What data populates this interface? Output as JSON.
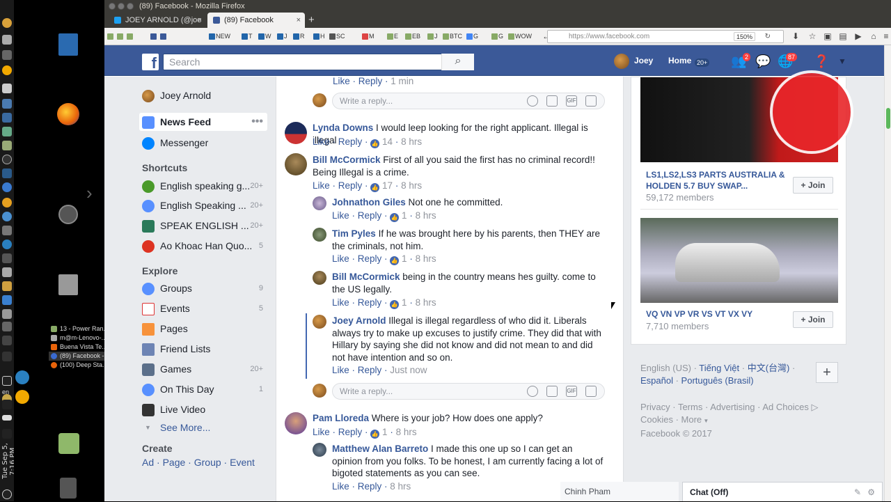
{
  "window": {
    "title": "(89) Facebook - Mozilla Firefox"
  },
  "os": {
    "lang": "en",
    "clock": "Tue Sep 5, 7:16 PM"
  },
  "tasks": [
    {
      "label": "13 - Power Ran..."
    },
    {
      "label": "m@m-Lenovo-..."
    },
    {
      "label": "Buena Vista Te..."
    },
    {
      "label": "(89) Facebook -..."
    },
    {
      "label": "(100) Deep Sta..."
    }
  ],
  "tabs": [
    {
      "label": "JOEY ARNOLD (@joe"
    },
    {
      "label": "(89) Facebook"
    }
  ],
  "bookmarks": [
    "NEW",
    "T",
    "W",
    "J",
    "R",
    "H",
    "SC",
    "M",
    "E",
    "EB",
    "J",
    "BTC",
    "G",
    "G",
    "WOW"
  ],
  "url": {
    "value": "https://www.facebook.com",
    "zoom": "150%"
  },
  "fb": {
    "search_placeholder": "Search",
    "profile_name": "Joey",
    "home_label": "Home",
    "home_badge": "20+",
    "friends_badge": "2",
    "notif_badge": "87"
  },
  "leftnav": {
    "profile": "Joey Arnold",
    "newsfeed": "News Feed",
    "messenger": "Messenger",
    "shortcuts_title": "Shortcuts",
    "shortcuts": [
      {
        "label": "English speaking g...",
        "count": "20+"
      },
      {
        "label": "English Speaking ...",
        "count": "20+"
      },
      {
        "label": "SPEAK ENGLISH ...",
        "count": "20+"
      },
      {
        "label": "Ao Khoac Han Quo...",
        "count": "5"
      }
    ],
    "explore_title": "Explore",
    "explore": [
      {
        "label": "Groups",
        "count": "9"
      },
      {
        "label": "Events",
        "count": "5"
      },
      {
        "label": "Pages",
        "count": ""
      },
      {
        "label": "Friend Lists",
        "count": ""
      },
      {
        "label": "Games",
        "count": "20+"
      },
      {
        "label": "On This Day",
        "count": "1"
      },
      {
        "label": "Live Video",
        "count": ""
      }
    ],
    "see_more": "See More...",
    "create_title": "Create",
    "create_links": [
      "Ad",
      "Page",
      "Group",
      "Event"
    ]
  },
  "feed": {
    "top_actions": {
      "like": "Like",
      "reply": "Reply",
      "time": "1 min"
    },
    "reply_placeholder": "Write a reply...",
    "comments": [
      {
        "name": "Lynda Downs",
        "text": "I would leep looking for the right applicant. Illegal is illegal",
        "like": "Like",
        "reply": "Reply",
        "likes": "14",
        "time": "8 hrs"
      },
      {
        "name": "Bill McCormick",
        "text": "First of all you said the first has no criminal record!! Being Illegal is a crime.",
        "like": "Like",
        "reply": "Reply",
        "likes": "17",
        "time": "8 hrs"
      },
      {
        "name": "Johnathon Giles",
        "text": "Not one he committed.",
        "like": "Like",
        "reply": "Reply",
        "likes": "1",
        "time": "8 hrs"
      },
      {
        "name": "Tim Pyles",
        "text": "If he was brought here by his parents, then THEY are the criminals, not him.",
        "like": "Like",
        "reply": "Reply",
        "likes": "1",
        "time": "8 hrs"
      },
      {
        "name": "Bill McCormick",
        "text": "being in the country means hes guilty. come to the US legally.",
        "like": "Like",
        "reply": "Reply",
        "likes": "1",
        "time": "8 hrs"
      },
      {
        "name": "Joey Arnold",
        "text": "Illegal is illegal regardless of who did it. Liberals always try to make up excuses to justify crime. They did that with Hillary by saying she did not know and did not mean to and did not have intention and so on.",
        "like": "Like",
        "reply": "Reply",
        "likes": "",
        "time": "Just now"
      },
      {
        "name": "Pam Lloreda",
        "text": "Where is your job? How does one apply?",
        "like": "Like",
        "reply": "Reply",
        "likes": "1",
        "time": "8 hrs"
      },
      {
        "name": "Matthew Alan Barreto",
        "text": "I made this one up so I can get an opinion from you folks. To be honest, I am currently facing a lot of bigoted statements as you can see.",
        "like": "Like",
        "reply": "Reply",
        "likes": "",
        "time": "8 hrs"
      }
    ]
  },
  "groups": [
    {
      "name": "LS1,LS2,LS3 PARTS AUSTRALIA & HOLDEN 5.7 BUY SWAP...",
      "members": "59,172 members",
      "join": "Join"
    },
    {
      "name": "VQ VN VP VR VS VT VX VY",
      "members": "7,710 members",
      "join": "Join"
    }
  ],
  "languages": {
    "current": "English (US)",
    "others": [
      "Tiếng Việt",
      "中文(台灣)",
      "Español",
      "Português (Brasil)"
    ]
  },
  "footer": {
    "links": [
      "Privacy",
      "Terms",
      "Advertising",
      "Ad Choices",
      "Cookies",
      "More"
    ],
    "copyright": "Facebook © 2017"
  },
  "chat": {
    "contact": "Chinh Pham",
    "status": "Chat (Off)"
  },
  "colors": {
    "fb_blue": "#3b5998",
    "link": "#365899",
    "badge_red": "#fa3e3e"
  }
}
